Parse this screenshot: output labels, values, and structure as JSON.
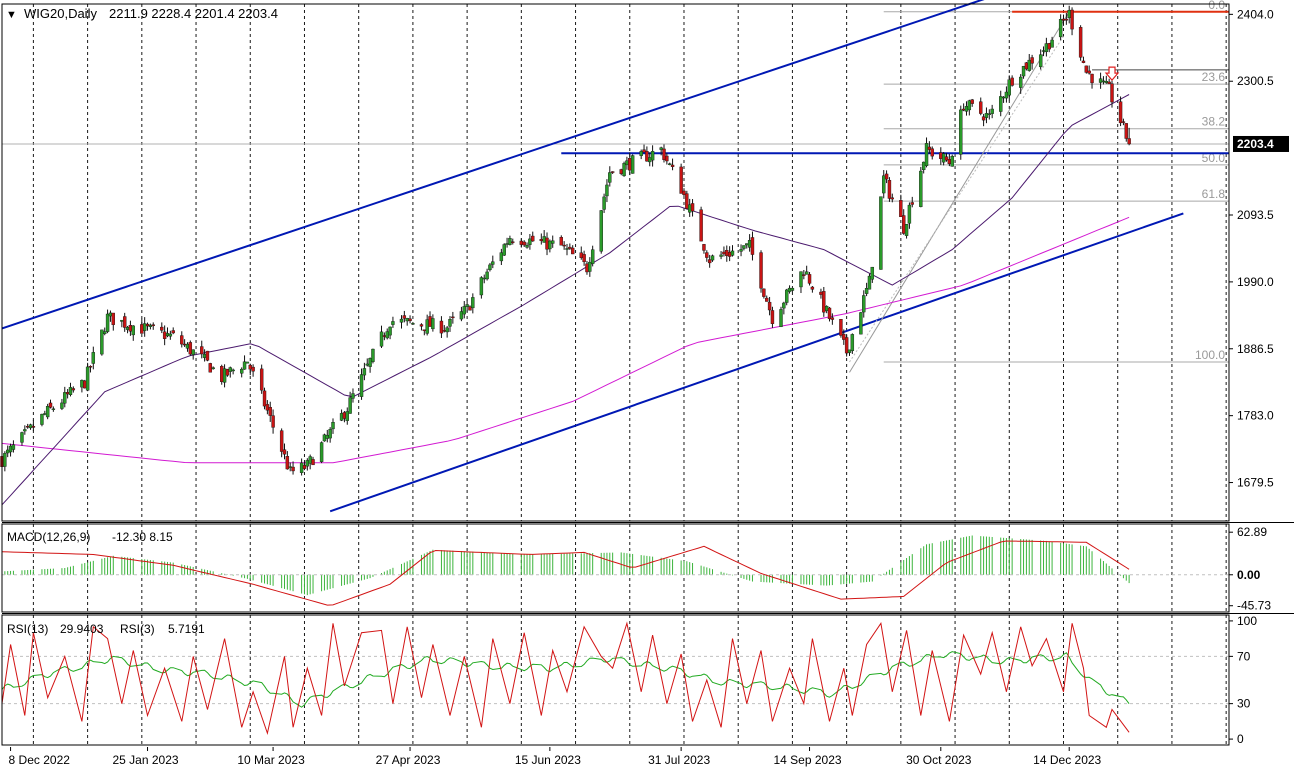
{
  "title": {
    "symbol_label": "WIG20,Daily",
    "ohlc": "2211.9 2228.4 2201.4 2203.4",
    "marker": "▼"
  },
  "colors": {
    "bull": "#2a9a2a",
    "bear": "#c81414",
    "wick": "#111111",
    "channel": "#0018b4",
    "sma50": "#4b1a6e",
    "sma200": "#d21ad2",
    "fib": "#a8a8a8",
    "resistance": "#e03010",
    "macd_hist": "#3cb43c",
    "macd_signal": "#d21414",
    "rsi13": "#22aa22",
    "rsi3": "#d21414",
    "arrow": "#e02020",
    "last_price_bg": "#000000",
    "last_price_fg": "#ffffff"
  },
  "chart_data": [
    {
      "type": "candlestick",
      "title": "WIG20,Daily",
      "ohlc_last": {
        "open": 2211.9,
        "high": 2228.4,
        "low": 2201.4,
        "close": 2203.4
      },
      "ylim": [
        1620,
        2420
      ],
      "y_ticks": [
        "2404.0",
        "2300.5",
        "2203.4",
        "2093.5",
        "1990.0",
        "1886.5",
        "1783.0",
        "1679.5"
      ],
      "last_price": "2203.4",
      "x_ticks": [
        "8 Dec 2022",
        "25 Jan 2023",
        "10 Mar 2023",
        "27 Apr 2023",
        "15 Jun 2023",
        "31 Jul 2023",
        "14 Sep 2023",
        "30 Oct 2023",
        "14 Dec 2023"
      ],
      "fibonacci_labels": [
        "0.0",
        "23.6",
        "38.2",
        "50.0",
        "61.8",
        "100.0"
      ],
      "fibonacci_levels": [
        2408,
        2296,
        2227,
        2171,
        2115,
        1866
      ],
      "resistance_level": 2408,
      "support_level": 2189,
      "channel_upper": [
        [
          "2022-12-05",
          1918
        ],
        [
          "2023-11-30",
          2451
        ]
      ],
      "channel_lower": [
        [
          "2023-03-30",
          1635
        ],
        [
          "2024-01-23",
          2096
        ]
      ],
      "close_path": [
        [
          "2022-12-05",
          1715
        ],
        [
          "2022-12-20",
          1785
        ],
        [
          "2023-01-03",
          1835
        ],
        [
          "2023-01-11",
          1935
        ],
        [
          "2023-01-20",
          1922
        ],
        [
          "2023-02-03",
          1905
        ],
        [
          "2023-02-14",
          1868
        ],
        [
          "2023-02-20",
          1842
        ],
        [
          "2023-03-01",
          1868
        ],
        [
          "2023-03-08",
          1790
        ],
        [
          "2023-03-16",
          1695
        ],
        [
          "2023-03-22",
          1705
        ],
        [
          "2023-04-05",
          1795
        ],
        [
          "2023-04-20",
          1930
        ],
        [
          "2023-05-10",
          1920
        ],
        [
          "2023-05-17",
          1948
        ],
        [
          "2023-05-24",
          2005
        ],
        [
          "2023-06-01",
          2060
        ],
        [
          "2023-06-19",
          2045
        ],
        [
          "2023-06-28",
          2012
        ],
        [
          "2023-07-06",
          2160
        ],
        [
          "2023-07-24",
          2195
        ],
        [
          "2023-07-31",
          2135
        ],
        [
          "2023-08-10",
          2025
        ],
        [
          "2023-08-24",
          2045
        ],
        [
          "2023-09-01",
          1935
        ],
        [
          "2023-09-12",
          2010
        ],
        [
          "2023-09-18",
          1960
        ],
        [
          "2023-09-27",
          1882
        ],
        [
          "2023-10-05",
          1990
        ],
        [
          "2023-10-10",
          2150
        ],
        [
          "2023-10-17",
          2075
        ],
        [
          "2023-10-25",
          2195
        ],
        [
          "2023-11-02",
          2175
        ],
        [
          "2023-11-07",
          2265
        ],
        [
          "2023-11-16",
          2245
        ],
        [
          "2023-11-24",
          2305
        ],
        [
          "2023-12-06",
          2355
        ],
        [
          "2023-12-14",
          2405
        ],
        [
          "2023-12-20",
          2315
        ],
        [
          "2023-12-28",
          2286
        ],
        [
          "2024-01-04",
          2203.4
        ]
      ],
      "sma50_path": [
        [
          "2022-12-05",
          1645
        ],
        [
          "2023-01-10",
          1820
        ],
        [
          "2023-02-08",
          1875
        ],
        [
          "2023-03-03",
          1895
        ],
        [
          "2023-04-06",
          1810
        ],
        [
          "2023-05-05",
          1875
        ],
        [
          "2023-06-06",
          1955
        ],
        [
          "2023-07-06",
          2035
        ],
        [
          "2023-07-28",
          2110
        ],
        [
          "2023-08-25",
          2070
        ],
        [
          "2023-09-19",
          2040
        ],
        [
          "2023-10-13",
          1985
        ],
        [
          "2023-11-03",
          2040
        ],
        [
          "2023-11-24",
          2120
        ],
        [
          "2023-12-14",
          2230
        ],
        [
          "2024-01-04",
          2280
        ]
      ],
      "sma200_path": [
        [
          "2022-12-05",
          1740
        ],
        [
          "2023-02-08",
          1710
        ],
        [
          "2023-03-31",
          1710
        ],
        [
          "2023-05-12",
          1745
        ],
        [
          "2023-06-23",
          1805
        ],
        [
          "2023-08-04",
          1895
        ],
        [
          "2023-09-26",
          1940
        ],
        [
          "2023-11-07",
          1985
        ],
        [
          "2024-01-04",
          2090
        ]
      ]
    },
    {
      "type": "bar",
      "title": "MACD(12,26,9)",
      "values_label": "-12.30 8.15",
      "ylim": [
        -55,
        75
      ],
      "y_ticks": [
        "62.89",
        "0.00",
        "-45.73"
      ],
      "histogram_path": [
        [
          "2022-12-05",
          5
        ],
        [
          "2022-12-27",
          10
        ],
        [
          "2023-01-13",
          28
        ],
        [
          "2023-02-03",
          18
        ],
        [
          "2023-03-01",
          -6
        ],
        [
          "2023-03-22",
          -30
        ],
        [
          "2023-04-13",
          -5
        ],
        [
          "2023-05-05",
          37
        ],
        [
          "2023-06-08",
          30
        ],
        [
          "2023-07-10",
          33
        ],
        [
          "2023-08-02",
          20
        ],
        [
          "2023-08-25",
          -10
        ],
        [
          "2023-09-20",
          -16
        ],
        [
          "2023-10-06",
          -10
        ],
        [
          "2023-10-25",
          45
        ],
        [
          "2023-11-10",
          58
        ],
        [
          "2023-12-06",
          50
        ],
        [
          "2023-12-20",
          42
        ],
        [
          "2024-01-04",
          -12.3
        ]
      ],
      "signal_path": [
        [
          "2022-12-05",
          34
        ],
        [
          "2023-01-06",
          30
        ],
        [
          "2023-02-03",
          14
        ],
        [
          "2023-03-03",
          -14
        ],
        [
          "2023-03-30",
          -46
        ],
        [
          "2023-04-20",
          -14
        ],
        [
          "2023-05-05",
          36
        ],
        [
          "2023-06-08",
          30
        ],
        [
          "2023-06-27",
          33
        ],
        [
          "2023-07-14",
          10
        ],
        [
          "2023-08-08",
          42
        ],
        [
          "2023-08-28",
          2
        ],
        [
          "2023-09-25",
          -36
        ],
        [
          "2023-10-17",
          -32
        ],
        [
          "2023-11-01",
          18
        ],
        [
          "2023-11-21",
          50
        ],
        [
          "2023-12-20",
          48
        ],
        [
          "2024-01-04",
          8.15
        ]
      ]
    },
    {
      "type": "line",
      "title": "RSI(13)",
      "series": [
        {
          "name": "RSI(13)",
          "last_value": "29.9403",
          "path": [
            [
              "2022-12-05",
              42
            ],
            [
              "2022-12-21",
              55
            ],
            [
              "2023-01-12",
              68
            ],
            [
              "2023-02-01",
              58
            ],
            [
              "2023-02-16",
              55
            ],
            [
              "2023-03-06",
              45
            ],
            [
              "2023-03-20",
              30
            ],
            [
              "2023-04-13",
              52
            ],
            [
              "2023-05-04",
              68
            ],
            [
              "2023-05-25",
              62
            ],
            [
              "2023-06-15",
              60
            ],
            [
              "2023-07-05",
              68
            ],
            [
              "2023-07-26",
              60
            ],
            [
              "2023-08-15",
              48
            ],
            [
              "2023-09-05",
              44
            ],
            [
              "2023-09-22",
              38
            ],
            [
              "2023-10-13",
              60
            ],
            [
              "2023-10-30",
              72
            ],
            [
              "2023-11-22",
              66
            ],
            [
              "2023-12-13",
              70
            ],
            [
              "2023-12-22",
              48
            ],
            [
              "2024-01-04",
              29.9403
            ]
          ]
        },
        {
          "name": "RSI(3)",
          "last_value": "5.7191",
          "path": [
            [
              "2022-12-05",
              30
            ],
            [
              "2022-12-08",
              80
            ],
            [
              "2022-12-13",
              20
            ],
            [
              "2022-12-16",
              90
            ],
            [
              "2022-12-21",
              35
            ],
            [
              "2022-12-27",
              70
            ],
            [
              "2023-01-02",
              15
            ],
            [
              "2023-01-06",
              95
            ],
            [
              "2023-01-11",
              85
            ],
            [
              "2023-01-16",
              30
            ],
            [
              "2023-01-20",
              75
            ],
            [
              "2023-01-25",
              20
            ],
            [
              "2023-01-31",
              60
            ],
            [
              "2023-02-06",
              15
            ],
            [
              "2023-02-10",
              70
            ],
            [
              "2023-02-15",
              25
            ],
            [
              "2023-02-21",
              85
            ],
            [
              "2023-02-27",
              10
            ],
            [
              "2023-03-03",
              40
            ],
            [
              "2023-03-08",
              5
            ],
            [
              "2023-03-14",
              70
            ],
            [
              "2023-03-17",
              10
            ],
            [
              "2023-03-22",
              60
            ],
            [
              "2023-03-27",
              20
            ],
            [
              "2023-03-31",
              98
            ],
            [
              "2023-04-04",
              45
            ],
            [
              "2023-04-10",
              90
            ],
            [
              "2023-04-17",
              92
            ],
            [
              "2023-04-21",
              30
            ],
            [
              "2023-04-26",
              95
            ],
            [
              "2023-05-01",
              35
            ],
            [
              "2023-05-05",
              80
            ],
            [
              "2023-05-11",
              20
            ],
            [
              "2023-05-16",
              70
            ],
            [
              "2023-05-22",
              10
            ],
            [
              "2023-05-26",
              85
            ],
            [
              "2023-06-01",
              30
            ],
            [
              "2023-06-06",
              90
            ],
            [
              "2023-06-12",
              20
            ],
            [
              "2023-06-16",
              75
            ],
            [
              "2023-06-21",
              40
            ],
            [
              "2023-06-27",
              95
            ],
            [
              "2023-07-03",
              70
            ],
            [
              "2023-07-07",
              60
            ],
            [
              "2023-07-12",
              98
            ],
            [
              "2023-07-17",
              40
            ],
            [
              "2023-07-21",
              88
            ],
            [
              "2023-07-26",
              30
            ],
            [
              "2023-07-31",
              72
            ],
            [
              "2023-08-04",
              15
            ],
            [
              "2023-08-09",
              50
            ],
            [
              "2023-08-14",
              10
            ],
            [
              "2023-08-18",
              85
            ],
            [
              "2023-08-23",
              30
            ],
            [
              "2023-08-28",
              75
            ],
            [
              "2023-09-01",
              15
            ],
            [
              "2023-09-07",
              60
            ],
            [
              "2023-09-12",
              30
            ],
            [
              "2023-09-15",
              85
            ],
            [
              "2023-09-21",
              15
            ],
            [
              "2023-09-26",
              60
            ],
            [
              "2023-09-29",
              20
            ],
            [
              "2023-10-04",
              80
            ],
            [
              "2023-10-09",
              98
            ],
            [
              "2023-10-13",
              40
            ],
            [
              "2023-10-18",
              92
            ],
            [
              "2023-10-23",
              20
            ],
            [
              "2023-10-27",
              75
            ],
            [
              "2023-11-02",
              15
            ],
            [
              "2023-11-07",
              88
            ],
            [
              "2023-11-13",
              55
            ],
            [
              "2023-11-17",
              90
            ],
            [
              "2023-11-22",
              40
            ],
            [
              "2023-11-27",
              95
            ],
            [
              "2023-12-01",
              62
            ],
            [
              "2023-12-06",
              85
            ],
            [
              "2023-12-12",
              40
            ],
            [
              "2023-12-15",
              98
            ],
            [
              "2023-12-19",
              60
            ],
            [
              "2023-12-21",
              20
            ],
            [
              "2023-12-27",
              10
            ],
            [
              "2023-12-29",
              25
            ],
            [
              "2024-01-04",
              5.7191
            ]
          ]
        }
      ],
      "ylim": [
        -5,
        105
      ],
      "y_ticks": [
        "100",
        "70",
        "30",
        "0"
      ],
      "levels": [
        70,
        30
      ]
    }
  ]
}
